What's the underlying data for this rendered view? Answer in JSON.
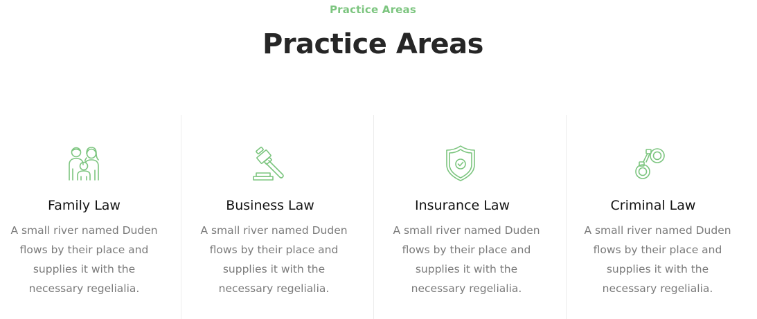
{
  "header": {
    "eyebrow": "Practice Areas",
    "title": "Practice Areas"
  },
  "colors": {
    "accent": "#7cc57f",
    "heading": "#262626",
    "text": "#7a7a7a"
  },
  "areas": [
    {
      "title": "Family Law",
      "description": "A small river named Duden flows by their place and supplies it with the necessary regelialia.",
      "icon": "family-icon"
    },
    {
      "title": "Business Law",
      "description": "A small river named Duden flows by their place and supplies it with the necessary regelialia.",
      "icon": "gavel-icon"
    },
    {
      "title": "Insurance Law",
      "description": "A small river named Duden flows by their place and supplies it with the necessary regelialia.",
      "icon": "shield-check-icon"
    },
    {
      "title": "Criminal Law",
      "description": "A small river named Duden flows by their place and supplies it with the necessary regelialia.",
      "icon": "handcuffs-icon"
    }
  ]
}
